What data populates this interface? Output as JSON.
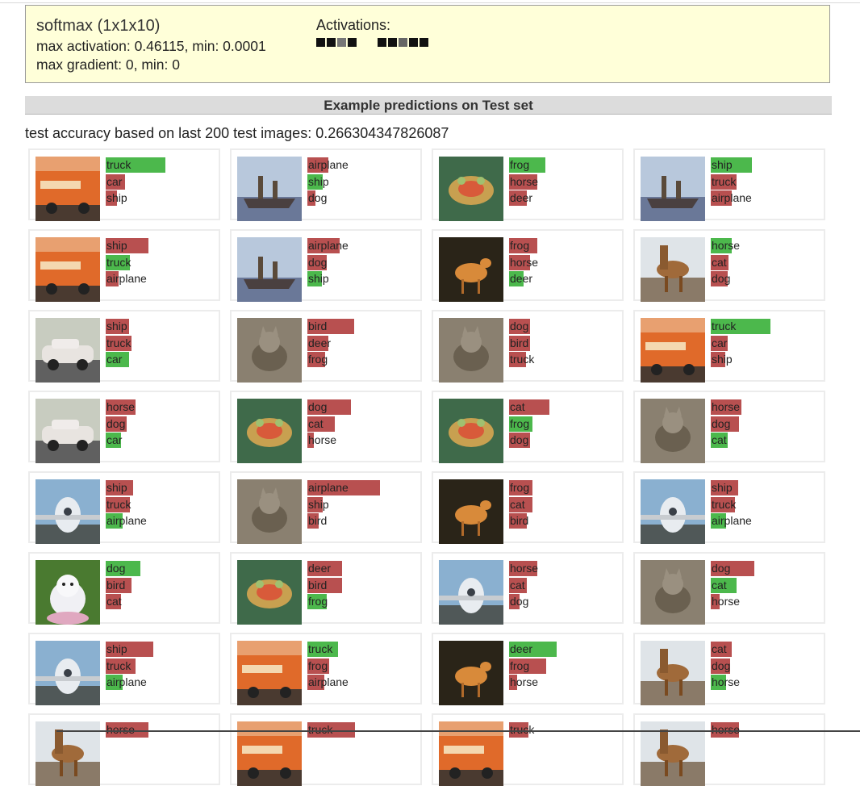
{
  "layer": {
    "title": "softmax (1x1x10)",
    "max_activation": "max activation: 0.46115, min: 0.0001",
    "max_gradient": "max gradient: 0, min: 0",
    "activations_label": "Activations:",
    "activation_groups": [
      [
        "#111111",
        "#111111",
        "#777777",
        "#111111"
      ],
      [
        "#111111",
        "#111111",
        "#666666",
        "#111111",
        "#111111"
      ]
    ]
  },
  "section": {
    "title": "Example predictions on Test set"
  },
  "accuracy": "test accuracy based on last 200 test images: 0.266304347826087",
  "colors": {
    "correct": "#4cb84c",
    "wrong": "#b85050"
  },
  "cards": [
    {
      "image": "truck",
      "preds": [
        {
          "label": "truck",
          "p": 0.46,
          "correct": true
        },
        {
          "label": "car",
          "p": 0.15,
          "correct": false
        },
        {
          "label": "ship",
          "p": 0.09,
          "correct": false
        }
      ]
    },
    {
      "image": "ship",
      "preds": [
        {
          "label": "airplane",
          "p": 0.16,
          "correct": false
        },
        {
          "label": "ship",
          "p": 0.12,
          "correct": true
        },
        {
          "label": "dog",
          "p": 0.06,
          "correct": false
        }
      ]
    },
    {
      "image": "frog",
      "preds": [
        {
          "label": "frog",
          "p": 0.28,
          "correct": true
        },
        {
          "label": "horse",
          "p": 0.22,
          "correct": false
        },
        {
          "label": "deer",
          "p": 0.14,
          "correct": false
        }
      ]
    },
    {
      "image": "ship",
      "preds": [
        {
          "label": "ship",
          "p": 0.32,
          "correct": true
        },
        {
          "label": "truck",
          "p": 0.2,
          "correct": false
        },
        {
          "label": "airplane",
          "p": 0.16,
          "correct": false
        }
      ]
    },
    {
      "image": "truck",
      "preds": [
        {
          "label": "ship",
          "p": 0.33,
          "correct": false
        },
        {
          "label": "truck",
          "p": 0.19,
          "correct": true
        },
        {
          "label": "airplane",
          "p": 0.1,
          "correct": false
        }
      ]
    },
    {
      "image": "ship",
      "preds": [
        {
          "label": "airplane",
          "p": 0.25,
          "correct": false
        },
        {
          "label": "dog",
          "p": 0.15,
          "correct": false
        },
        {
          "label": "ship",
          "p": 0.11,
          "correct": true
        }
      ]
    },
    {
      "image": "deer",
      "preds": [
        {
          "label": "frog",
          "p": 0.22,
          "correct": false
        },
        {
          "label": "horse",
          "p": 0.16,
          "correct": false
        },
        {
          "label": "deer",
          "p": 0.11,
          "correct": true
        }
      ]
    },
    {
      "image": "horse",
      "preds": [
        {
          "label": "horse",
          "p": 0.16,
          "correct": true
        },
        {
          "label": "cat",
          "p": 0.14,
          "correct": false
        },
        {
          "label": "dog",
          "p": 0.13,
          "correct": false
        }
      ]
    },
    {
      "image": "car",
      "preds": [
        {
          "label": "ship",
          "p": 0.18,
          "correct": false
        },
        {
          "label": "truck",
          "p": 0.2,
          "correct": false
        },
        {
          "label": "car",
          "p": 0.18,
          "correct": true
        }
      ]
    },
    {
      "image": "cat",
      "preds": [
        {
          "label": "bird",
          "p": 0.36,
          "correct": false
        },
        {
          "label": "deer",
          "p": 0.16,
          "correct": false
        },
        {
          "label": "frog",
          "p": 0.14,
          "correct": false
        }
      ]
    },
    {
      "image": "cat",
      "preds": [
        {
          "label": "dog",
          "p": 0.16,
          "correct": false
        },
        {
          "label": "bird",
          "p": 0.16,
          "correct": false
        },
        {
          "label": "truck",
          "p": 0.13,
          "correct": false
        }
      ]
    },
    {
      "image": "truck",
      "preds": [
        {
          "label": "truck",
          "p": 0.46,
          "correct": true
        },
        {
          "label": "car",
          "p": 0.13,
          "correct": false
        },
        {
          "label": "ship",
          "p": 0.11,
          "correct": false
        }
      ]
    },
    {
      "image": "car",
      "preds": [
        {
          "label": "horse",
          "p": 0.23,
          "correct": false
        },
        {
          "label": "dog",
          "p": 0.16,
          "correct": false
        },
        {
          "label": "car",
          "p": 0.12,
          "correct": true
        }
      ]
    },
    {
      "image": "frog",
      "preds": [
        {
          "label": "dog",
          "p": 0.34,
          "correct": false
        },
        {
          "label": "cat",
          "p": 0.21,
          "correct": false
        },
        {
          "label": "horse",
          "p": 0.05,
          "correct": false
        }
      ]
    },
    {
      "image": "frog",
      "preds": [
        {
          "label": "cat",
          "p": 0.31,
          "correct": false
        },
        {
          "label": "frog",
          "p": 0.18,
          "correct": true
        },
        {
          "label": "dog",
          "p": 0.16,
          "correct": false
        }
      ]
    },
    {
      "image": "cat",
      "preds": [
        {
          "label": "horse",
          "p": 0.24,
          "correct": false
        },
        {
          "label": "dog",
          "p": 0.22,
          "correct": false
        },
        {
          "label": "cat",
          "p": 0.13,
          "correct": true
        }
      ]
    },
    {
      "image": "airplane",
      "preds": [
        {
          "label": "ship",
          "p": 0.21,
          "correct": false
        },
        {
          "label": "truck",
          "p": 0.19,
          "correct": false
        },
        {
          "label": "airplane",
          "p": 0.13,
          "correct": true
        }
      ]
    },
    {
      "image": "cat",
      "preds": [
        {
          "label": "airplane",
          "p": 0.56,
          "correct": false
        },
        {
          "label": "ship",
          "p": 0.12,
          "correct": false
        },
        {
          "label": "bird",
          "p": 0.09,
          "correct": false
        }
      ]
    },
    {
      "image": "deer",
      "preds": [
        {
          "label": "frog",
          "p": 0.18,
          "correct": false
        },
        {
          "label": "cat",
          "p": 0.18,
          "correct": false
        },
        {
          "label": "bird",
          "p": 0.14,
          "correct": false
        }
      ]
    },
    {
      "image": "airplane",
      "preds": [
        {
          "label": "ship",
          "p": 0.21,
          "correct": false
        },
        {
          "label": "truck",
          "p": 0.19,
          "correct": false
        },
        {
          "label": "airplane",
          "p": 0.12,
          "correct": true
        }
      ]
    },
    {
      "image": "dog",
      "preds": [
        {
          "label": "dog",
          "p": 0.27,
          "correct": true
        },
        {
          "label": "bird",
          "p": 0.2,
          "correct": false
        },
        {
          "label": "cat",
          "p": 0.12,
          "correct": false
        }
      ]
    },
    {
      "image": "frog",
      "preds": [
        {
          "label": "deer",
          "p": 0.27,
          "correct": false
        },
        {
          "label": "bird",
          "p": 0.27,
          "correct": false
        },
        {
          "label": "frog",
          "p": 0.15,
          "correct": true
        }
      ]
    },
    {
      "image": "airplane",
      "preds": [
        {
          "label": "horse",
          "p": 0.22,
          "correct": false
        },
        {
          "label": "cat",
          "p": 0.14,
          "correct": false
        },
        {
          "label": "dog",
          "p": 0.08,
          "correct": false
        }
      ]
    },
    {
      "image": "cat",
      "preds": [
        {
          "label": "dog",
          "p": 0.34,
          "correct": false
        },
        {
          "label": "cat",
          "p": 0.2,
          "correct": true
        },
        {
          "label": "horse",
          "p": 0.07,
          "correct": false
        }
      ]
    },
    {
      "image": "airplane",
      "preds": [
        {
          "label": "ship",
          "p": 0.37,
          "correct": false
        },
        {
          "label": "truck",
          "p": 0.23,
          "correct": false
        },
        {
          "label": "airplane",
          "p": 0.13,
          "correct": true
        }
      ]
    },
    {
      "image": "truck",
      "preds": [
        {
          "label": "truck",
          "p": 0.24,
          "correct": true
        },
        {
          "label": "frog",
          "p": 0.17,
          "correct": false
        },
        {
          "label": "airplane",
          "p": 0.13,
          "correct": false
        }
      ]
    },
    {
      "image": "deer",
      "preds": [
        {
          "label": "deer",
          "p": 0.37,
          "correct": true
        },
        {
          "label": "frog",
          "p": 0.29,
          "correct": false
        },
        {
          "label": "horse",
          "p": 0.06,
          "correct": false
        }
      ]
    },
    {
      "image": "horse",
      "preds": [
        {
          "label": "cat",
          "p": 0.16,
          "correct": false
        },
        {
          "label": "dog",
          "p": 0.15,
          "correct": false
        },
        {
          "label": "horse",
          "p": 0.12,
          "correct": true
        }
      ]
    },
    {
      "image": "horse",
      "preds": [
        {
          "label": "horse",
          "p": 0.33,
          "correct": false
        }
      ]
    },
    {
      "image": "truck",
      "preds": [
        {
          "label": "truck",
          "p": 0.37,
          "correct": false
        }
      ]
    },
    {
      "image": "truck",
      "preds": [
        {
          "label": "truck",
          "p": 0.15,
          "correct": false
        }
      ]
    },
    {
      "image": "horse",
      "preds": [
        {
          "label": "horse",
          "p": 0.22,
          "correct": false
        }
      ]
    }
  ]
}
